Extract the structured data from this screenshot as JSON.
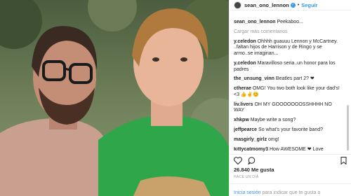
{
  "header": {
    "username": "sean_ono_lennon",
    "follow_label": "Seguir",
    "dot": "•"
  },
  "load_more": "Cargar más comentarios",
  "comments": [
    {
      "user": "sean_ono_lennon",
      "text": "Peekaboo..."
    },
    {
      "user": "y.celedon",
      "text": "Ohhhh guauuu Lennon y McCartney. ..faltan hijos de Harrison y de Ringo y se armo..se imaginan..."
    },
    {
      "user": "y.celedon",
      "text": "Maravilloso seria..un honor para los padres"
    },
    {
      "user": "the_unsung_vinn",
      "text": "Beatles part 2? ❤"
    },
    {
      "user": "ctherae",
      "text": "OMG! You two both look like your dad's! <3 👍✌😊"
    },
    {
      "user": "liv.livers",
      "text": "OH MY GOOOOOOOSSHHHH NO WAY"
    },
    {
      "user": "xhkpw",
      "text": "Maybe write a song?"
    },
    {
      "user": "jeffpearce",
      "text": "So what's your favorite band?"
    },
    {
      "user": "masgirly_girlz",
      "text": "omg!"
    },
    {
      "user": "kittycatmomy3",
      "text": "How AWESOME ❤ Love"
    }
  ],
  "likes": "26.840 Me gusta",
  "time_ago": "HACE UN DÍA",
  "login": {
    "link": "Inicia sesión",
    "text": " para indicar que te gusta o"
  },
  "colors": {
    "accent": "#3897f0",
    "text": "#262626",
    "muted": "#999999"
  },
  "icons": [
    "verified-badge-icon",
    "heart-icon",
    "comment-icon",
    "bookmark-icon"
  ]
}
